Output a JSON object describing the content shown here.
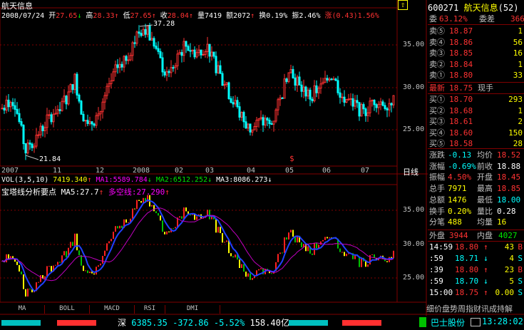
{
  "stock": {
    "name": "航天信息",
    "code": "600271"
  },
  "header": {
    "date": "2008/07/24",
    "open_label": "开",
    "open": "27.65",
    "open_arrow": "↓",
    "high_label": "高",
    "high": "28.33",
    "high_arrow": "↑",
    "low_label": "低",
    "low": "27.65",
    "low_arrow": "↑",
    "close_label": "收",
    "close": "28.04",
    "close_arrow": "↑",
    "vol_label": "量",
    "vol": "7419",
    "amt_label": "额",
    "amt": "2072",
    "turn_label": "换",
    "turn": "0.19%",
    "amp_label": "振",
    "amp": "2.46%",
    "chg_label": "涨",
    "chg": "(0.43)1.56%"
  },
  "price_chart": {
    "y_labels": [
      "35.00",
      "30.00",
      "25.00"
    ],
    "high_mark": "37.28",
    "low_mark": "21.84",
    "period_label": "日线",
    "x_labels": [
      "2007",
      "11",
      "12",
      "2008",
      "02",
      "03",
      "04",
      "05",
      "06",
      "07"
    ]
  },
  "vol_indicator": {
    "label": "VOL(3,5,10)",
    "value": "7419.340",
    "ma1_label": "MA1:",
    "ma1": "5589.784",
    "ma1_arrow": "↓",
    "ma2_label": "MA2:",
    "ma2": "6512.252",
    "ma2_arrow": "↓",
    "ma3_label": "MA3:",
    "ma3": "8086.273",
    "ma3_arrow": "↓"
  },
  "lower_chart": {
    "title": "宝塔线分析要点",
    "ma5_label": "MA5:",
    "ma5": "27.7",
    "ma5_arrow": "↑",
    "dk_label": "多空线:",
    "dk": "27.290",
    "dk_arrow": "↑",
    "y_labels": [
      "35.00",
      "30.00",
      "25.00"
    ]
  },
  "tabs": [
    "MA",
    "BOLL",
    "MACD",
    "RSI",
    "DMI"
  ],
  "status_bar": {
    "index_name": "深",
    "index_value": "6385.35",
    "change": "-372.86",
    "pct": "-5.52%",
    "amount": "158.40亿",
    "ticker_name": "巴士股份",
    "time": "13:28:02"
  },
  "right_panel": {
    "title_code": "600271",
    "title_name": "航天信息",
    "title_extra": "(52)",
    "weibi_label": "委",
    "weibi": "63.12%",
    "weicha_label": "委差",
    "weicha": "366",
    "sells": [
      {
        "label": "卖⑤",
        "price": "18.87",
        "vol": "1"
      },
      {
        "label": "卖④",
        "price": "18.86",
        "vol": "56"
      },
      {
        "label": "卖③",
        "price": "18.85",
        "vol": "16"
      },
      {
        "label": "卖②",
        "price": "18.84",
        "vol": "1"
      },
      {
        "label": "卖①",
        "price": "18.80",
        "vol": "33"
      }
    ],
    "last_label": "最新",
    "last": "18.75",
    "now_label": "现手",
    "buys": [
      {
        "label": "买①",
        "price": "18.70",
        "vol": "293"
      },
      {
        "label": "买②",
        "price": "18.68",
        "vol": "1"
      },
      {
        "label": "买③",
        "price": "18.61",
        "vol": "2"
      },
      {
        "label": "买④",
        "price": "18.60",
        "vol": "150"
      },
      {
        "label": "买⑤",
        "price": "18.58",
        "vol": "28"
      }
    ],
    "stats": [
      {
        "k1": "涨跌",
        "v1": "-0.13",
        "k2": "均价",
        "v2": "18.52"
      },
      {
        "k1": "涨幅",
        "v1": "-0.69%",
        "k2": "前收",
        "v2": "18.88"
      },
      {
        "k1": "振幅",
        "v1": "4.50%",
        "k2": "开盘",
        "v2": "18.45"
      },
      {
        "k1": "总手",
        "v1": "7971",
        "k2": "最高",
        "v2": "18.85"
      },
      {
        "k1": "总额",
        "v1": "1476",
        "k2": "最低",
        "v2": "18.00"
      },
      {
        "k1": "换手",
        "v1": "0.20%",
        "k2": "量比",
        "v2": "0.28"
      },
      {
        "k1": "分笔",
        "v1": "488",
        "k2": "均量",
        "v2": "16"
      }
    ],
    "outer_label": "外盘",
    "outer": "3944",
    "inner_label": "内盘",
    "inner": "4027",
    "ticks": [
      {
        "t": "14:59",
        "p": "18.80",
        "a": "↑",
        "v": "43",
        "s": "B"
      },
      {
        "t": ":59",
        "p": "18.71",
        "a": "↓",
        "v": "4",
        "s": "S"
      },
      {
        "t": ":39",
        "p": "18.80",
        "a": "↑",
        "v": "23",
        "s": "B"
      },
      {
        "t": ":59",
        "p": "18.70",
        "a": "↓",
        "v": "5",
        "s": "S"
      },
      {
        "t": "15:00",
        "p": "18.75",
        "a": "↑",
        "v": "0.00",
        "s": "S"
      }
    ],
    "bottom_tabs": "细价盘势周指财讯成持解"
  },
  "colors": {
    "up": "#ff3232",
    "down": "#00ffff",
    "grid": "#800000",
    "ma_blue": "#0000ff",
    "ma_magenta": "#c000c0"
  }
}
